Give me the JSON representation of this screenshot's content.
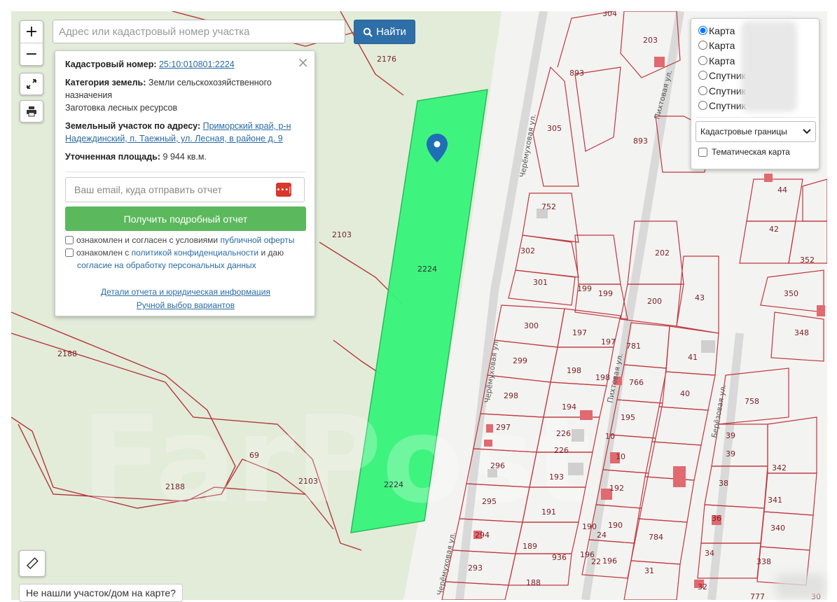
{
  "search": {
    "placeholder": "Адрес или кадастровый номер участка",
    "button_label": "Найти",
    "button_icon": "search-icon"
  },
  "zoom": {
    "in_label": "+",
    "out_label": "−"
  },
  "popup": {
    "cadastral_label": "Кадастровый номер:",
    "cadastral_value": "25:10:010801:2224",
    "category_label": "Категория земель:",
    "category_value": "Земли сельскохозяйственного назначения",
    "use_value": "Заготовка лесных ресурсов",
    "address_label": "Земельный участок по адресу:",
    "address_value": "Приморский край, р-н Надеждинский, п. Таежный, ул. Лесная, в районе д. 9",
    "area_label": "Уточненная площадь:",
    "area_value": "9 944 кв.м.",
    "email_placeholder": "Ваш email, куда отправить отчет",
    "email_icon_text": "•••|",
    "report_button": "Получить подробный отчет",
    "check1_text": "ознакомлен и согласен с условиями",
    "check1_link": "публичной оферты",
    "check2_text_a": "ознакомлен с",
    "check2_link_a": "политикой конфиденциальности",
    "check2_text_b": "и даю",
    "check2_link_b": "согласие на обработку персональных данных",
    "details_link": "Детали отчета и юридическая информация",
    "manual_link": "Ручной выбор вариантов",
    "close_label": "×"
  },
  "layers": {
    "items": [
      {
        "label": "Карта",
        "checked": true
      },
      {
        "label": "Карта",
        "checked": false
      },
      {
        "label": "Карта",
        "checked": false
      },
      {
        "label": "Спутник",
        "checked": false
      },
      {
        "label": "Спутник",
        "checked": false
      },
      {
        "label": "Спутник",
        "checked": false
      }
    ],
    "select_value": "Кадастровые границы",
    "thematic_label": "Тематическая карта"
  },
  "bottom": {
    "not_found": "Не нашли участок/дом на карте?"
  },
  "streets": [
    "Черёмуховая ул.",
    "Пихтовая ул.",
    "Берёзовая ул."
  ],
  "plot_labels": [
    "2176",
    "2224",
    "2103",
    "2188",
    "69",
    "2188",
    "2103",
    "2224",
    "304",
    "203",
    "893",
    "305",
    "893",
    "752",
    "302",
    "301",
    "199",
    "199",
    "200",
    "43",
    "202",
    "300",
    "197",
    "197",
    "781",
    "41",
    "299",
    "198",
    "198",
    "766",
    "298",
    "194",
    "195",
    "40",
    "297",
    "226",
    "226",
    "10",
    "10",
    "296",
    "193",
    "192",
    "295",
    "191",
    "190",
    "190",
    "294",
    "189",
    "936",
    "196",
    "196",
    "784",
    "293",
    "188",
    "31",
    "44",
    "42",
    "352",
    "350",
    "348",
    "758",
    "39",
    "39",
    "342",
    "38",
    "341",
    "36",
    "340",
    "34",
    "338",
    "32",
    "777",
    "30",
    "24",
    "22"
  ],
  "map_labels": [
    "2176",
    "2103",
    "2188",
    "2188",
    "69",
    "2103",
    "2224",
    "2224"
  ],
  "colors": {
    "selected_parcel": "#36f57a",
    "parcel_border": "#c0373f",
    "search_button": "#2f6fa8",
    "report_button": "#5cb85c",
    "marker": "#1e6fb5"
  }
}
